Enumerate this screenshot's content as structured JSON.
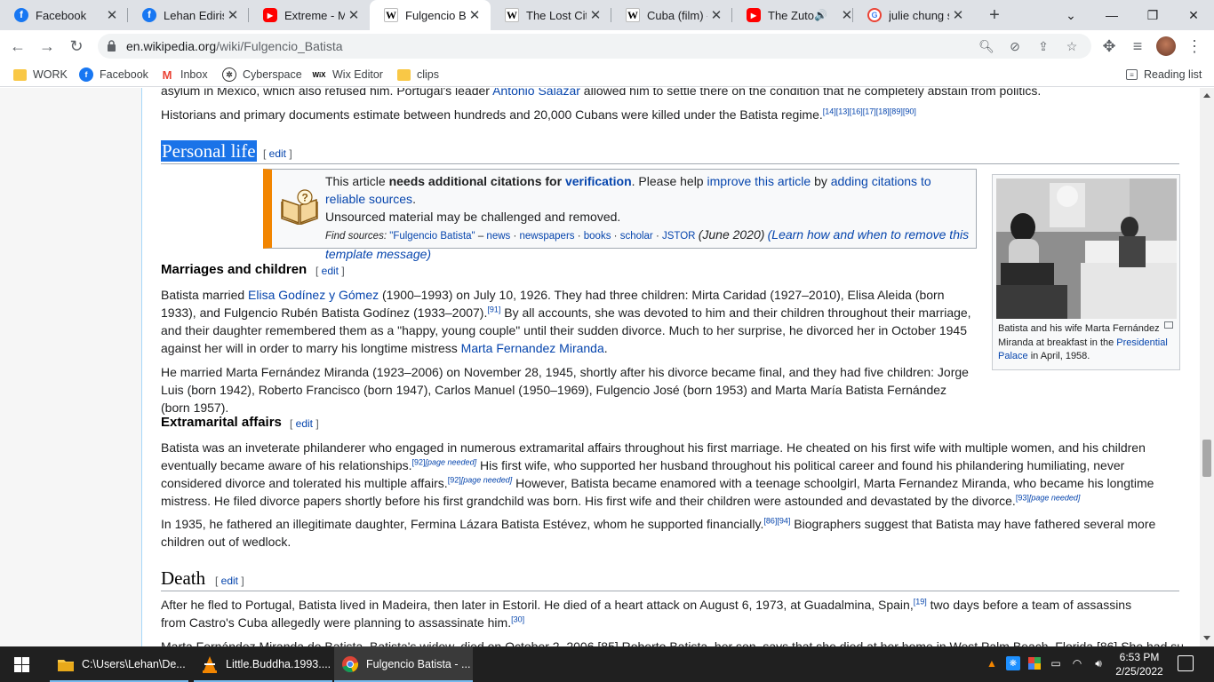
{
  "browser": {
    "tabs": [
      {
        "title": "Facebook",
        "icon": "facebook-icon"
      },
      {
        "title": "Lehan Edirisin",
        "icon": "facebook-icon"
      },
      {
        "title": "Extreme - Mo",
        "icon": "youtube-icon"
      },
      {
        "title": "Fulgencio Bat",
        "icon": "wikipedia-icon"
      },
      {
        "title": "The Lost City",
        "icon": "wikipedia-icon"
      },
      {
        "title": "Cuba (film) -",
        "icon": "wikipedia-icon"
      },
      {
        "title": "The Zuto",
        "icon": "youtube-icon"
      },
      {
        "title": "julie chung sv",
        "icon": "google-icon"
      }
    ],
    "url_host": "en.wikipedia.org",
    "url_path": "/wiki/Fulgencio_Batista",
    "bookmarks": [
      {
        "label": "WORK",
        "icon": "folder-icon"
      },
      {
        "label": "Facebook",
        "icon": "facebook-icon"
      },
      {
        "label": "Inbox",
        "icon": "gmail-icon"
      },
      {
        "label": "Cyberspace",
        "icon": "cyberspace-icon"
      },
      {
        "label": "Wix Editor",
        "icon": "wix-icon"
      },
      {
        "label": "clips",
        "icon": "folder-icon"
      }
    ],
    "reading_list": "Reading list"
  },
  "article": {
    "partial_top": "asylum in Mexico, which also refused him. Portugal's leader Antonio Salazar allowed him to settle there on the condition that he completely abstain from politics.",
    "partial_top_link": "Antonio Salazar",
    "historians_text": "Historians and primary documents estimate between hundreds and 20,000 Cubans were killed under the Batista regime.",
    "historians_refs": "[14][13][16][17][18][89][90]",
    "personal_life": "Personal life",
    "edit": "edit",
    "ambox": {
      "line1_a": "This article ",
      "line1_b": "needs additional citations for ",
      "line1_c": "verification",
      "line1_d": ". Please help ",
      "line1_e": "improve this article",
      "line1_f": " by ",
      "line1_g": "adding citations to reliable sources",
      "line1_h": ".",
      "line2": "Unsourced material may be challenged and removed.",
      "find_sources": "Find sources:",
      "query": "\"Fulgencio Batista\"",
      "news": "news",
      "newspapers": "newspapers",
      "books": "books",
      "scholar": "scholar",
      "jstor": "JSTOR",
      "date": "(June 2020)",
      "learn": "(Learn how and when to remove this template message)"
    },
    "marriages_heading": "Marriages and children",
    "m_p1_a": "Batista married ",
    "m_p1_link1": "Elisa Godínez y Gómez",
    "m_p1_b": " (1900–1993) on July 10, 1926. They had three children: Mirta Caridad (1927–2010), Elisa Aleida (born 1933), and Fulgencio Rubén Batista Godínez (1933–2007).",
    "m_p1_ref": "[91]",
    "m_p1_c": " By all accounts, she was devoted to him and their children throughout their marriage, and their daughter remembered them as a \"happy, young couple\" until their sudden divorce. Much to her surprise, he divorced her in October 1945 against her will in order to marry his longtime mistress ",
    "m_p1_link2": "Marta Fernandez Miranda",
    "m_p1_d": ".",
    "m_p2": "He married Marta Fernández Miranda (1923–2006) on November 28, 1945, shortly after his divorce became final, and they had five children: Jorge Luis (born 1942), Roberto Francisco (born 1947), Carlos Manuel (1950–1969), Fulgencio José (born 1953) and Marta María Batista Fernández (born 1957).",
    "extra_heading": "Extramarital affairs",
    "e_p1_a": "Batista was an inveterate philanderer who engaged in numerous extramarital affairs throughout his first marriage. He cheated on his first wife with multiple women, and his children eventually became aware of his relationships.",
    "e_ref1": "[92]",
    "page_needed": "[page needed]",
    "e_p1_b": " His first wife, who supported her husband throughout his political career and found his philandering humiliating, never considered divorce and tolerated his multiple affairs.",
    "e_ref2": "[92]",
    "e_p1_c": " However, Batista became enamored with a teenage schoolgirl, Marta Fernandez Miranda, who became his longtime mistress. He filed divorce papers shortly before his first grandchild was born. His first wife and their children were astounded and devastated by the divorce.",
    "e_ref3": "[93]",
    "e_p2_a": "In 1935, he fathered an illegitimate daughter, Fermina Lázara Batista Estévez, whom he supported financially.",
    "e_p2_ref": "[86][94]",
    "e_p2_b": " Biographers suggest that Batista may have fathered several more children out of wedlock.",
    "death_heading": "Death",
    "d_p1_a": "After he fled to Portugal, Batista lived in Madeira, then later in Estoril. He died of a heart attack on August 6, 1973, at Guadalmina, Spain,",
    "d_ref1": "[19]",
    "d_p1_b": " two days before a team of assassins from Castro's Cuba allegedly were planning to assassinate him.",
    "d_ref2": "[30]",
    "d_p2_partial": "Marta Fernández Miranda de Batista, Batista's widow, died on October 2, 2006.[85] Roberto Batista, her son, says that she died at her home in West Palm Beach, Florida.[86] She had suffered from",
    "thumb_caption_a": "Batista and his wife Marta Fernández Miranda at breakfast in the ",
    "thumb_caption_link": "Presidential Palace",
    "thumb_caption_b": " in April, 1958."
  },
  "taskbar": {
    "items": [
      {
        "label": "C:\\Users\\Lehan\\De...",
        "icon": "file-explorer-icon"
      },
      {
        "label": "Little.Buddha.1993....",
        "icon": "vlc-icon"
      },
      {
        "label": "Fulgencio Batista - ...",
        "icon": "chrome-icon"
      }
    ],
    "time": "6:53 PM",
    "date": "2/25/2022"
  }
}
